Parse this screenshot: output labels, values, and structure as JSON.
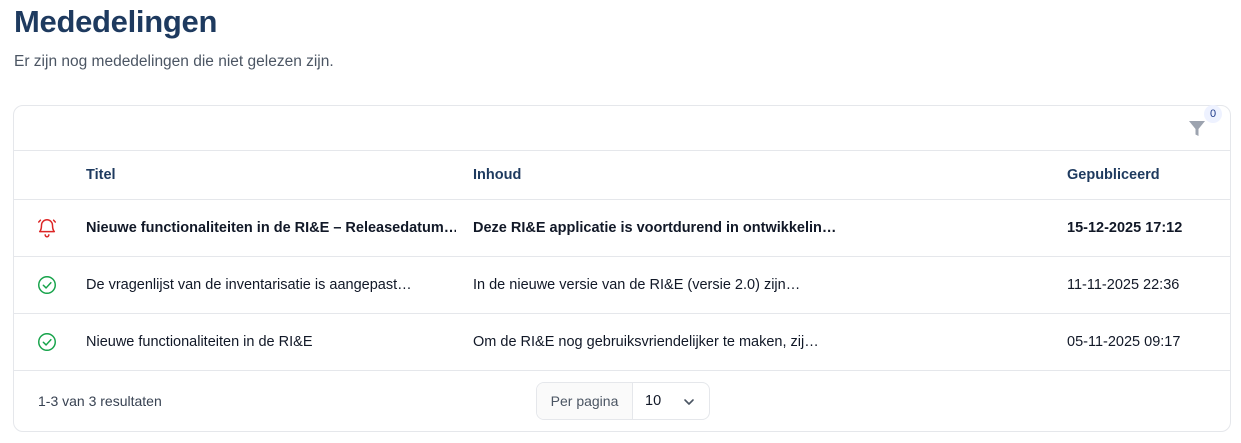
{
  "page": {
    "title": "Mededelingen",
    "subtitle": "Er zijn nog mededelingen die niet gelezen zijn."
  },
  "filter": {
    "icon": "filter-icon",
    "count": "0"
  },
  "table": {
    "headers": {
      "title": "Titel",
      "content": "Inhoud",
      "published": "Gepubliceerd"
    },
    "rows": [
      {
        "status": "unread",
        "icon": "bell-icon",
        "title": "Nieuwe functionaliteiten in de RI&E – Releasedatum…",
        "content": "Deze RI&E applicatie is voortdurend in ontwikkelin…",
        "published": "15-12-2025 17:12"
      },
      {
        "status": "read",
        "icon": "check-circle-icon",
        "title": "De vragenlijst van de inventarisatie is aangepast…",
        "content": "In de nieuwe versie van de RI&E (versie 2.0) zijn…",
        "published": "11-11-2025 22:36"
      },
      {
        "status": "read",
        "icon": "check-circle-icon",
        "title": "Nieuwe functionaliteiten in de RI&E",
        "content": "Om de RI&E nog gebruiksvriendelijker te maken, zij…",
        "published": "05-11-2025 09:17"
      }
    ]
  },
  "pagination": {
    "results": "1-3 van 3 resultaten",
    "per_page_label": "Per pagina",
    "per_page_value": "10"
  },
  "colors": {
    "title": "#1e3a5f",
    "unread_icon": "#dc2626",
    "read_icon": "#16a34a",
    "border": "#e5e7eb"
  }
}
